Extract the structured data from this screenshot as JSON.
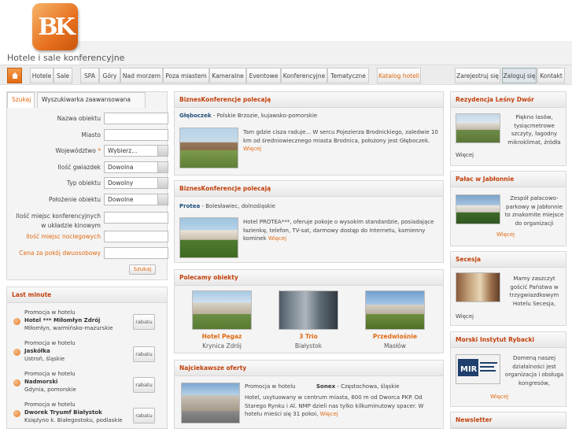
{
  "site": {
    "logo_text": "BK",
    "tagline": "Hotele i sale konferencyjne"
  },
  "nav": {
    "home_icon": "home-icon",
    "items": [
      "Hotele",
      "Sale",
      "SPA",
      "Góry",
      "Nad morzem",
      "Poza miastem",
      "Kameralne",
      "Eventowe",
      "Konferencyjne",
      "Tematyczne"
    ],
    "catalog": "Katalog hoteli",
    "register": "Zarejestruj się",
    "login": "Zaloguj się",
    "contact": "Kontakt"
  },
  "search": {
    "tab_simple": "Szukaj",
    "tab_advanced": "Wyszukiwarka zaawansowana",
    "label_name": "Nazwa obiektu",
    "label_city": "Miasto",
    "label_province": "Województwo",
    "province_value": "Wybierz...",
    "label_stars": "Ilość gwiazdek",
    "stars_value": "Dowolna",
    "label_type": "Typ obiektu",
    "type_value": "Dowolny",
    "label_location": "Położenie obiektu",
    "location_value": "Dowolne",
    "label_conf_line1": "Ilość miejsc konferencyjnych",
    "label_conf_line2": "w układzie kinowym",
    "label_beds": "Ilość miejsc noclegowych",
    "label_price": "Cena za pokój dwuosobowy",
    "submit": "Szukaj"
  },
  "last_minute": {
    "title": "Last minute",
    "items": [
      {
        "promo": "Promocja w hotelu",
        "name": "Hotel *** Miłomłyn Zdrój",
        "place": "Miłomłyn, warmińsko-mazurskie",
        "badge": "rabatu"
      },
      {
        "promo": "Promocja w hotelu",
        "name": "Jaskółka",
        "place": "Ustroń, śląskie",
        "badge": "rabatu"
      },
      {
        "promo": "Promocja w hotelu",
        "name": "Nadmorski",
        "place": "Gdynia, pomorskie",
        "badge": "rabatu"
      },
      {
        "promo": "Promocja w hotelu",
        "name": "Dworek Tryumf Białystok",
        "place": "Księżyno k. Białegostoku, podlaskie",
        "badge": "rabatu"
      }
    ]
  },
  "recommend1": {
    "title": "BiznesKonferencje polecają",
    "name": "Głęboczek",
    "location": " - Polskie Brzozie, kujawsko-pomorskie",
    "text": "Tam gdzie cisza raduje... W sercu Pojezierza Brodnickiego, zaledwie 10 km od średniowiecznego miasta Brodnica, położony jest Głęboczek.",
    "more": "Więcej"
  },
  "recommend2": {
    "title": "BiznesKonferencje polecają",
    "name": "Protea",
    "location": " - Bolesławiec, dolnośląskie",
    "text": "Hotel PROTEA***, oferuje pokoje o wysokim standardzie, posiadające łazienkę, telefon, TV-sat, darmowy dostęp do Internetu, kamienny kominek",
    "more": "Więcej"
  },
  "featured": {
    "title": "Polecamy obiekty",
    "items": [
      {
        "name": "Hotel Pegaz",
        "city": "Krynica Zdrój"
      },
      {
        "name": "3 Trio",
        "city": "Białystok"
      },
      {
        "name": "Przedwiośnie",
        "city": "Masłów"
      }
    ]
  },
  "offers": {
    "title": "Najciekawsze oferty",
    "promo": "Promocja w hotelu",
    "name": "Sonex",
    "location": " - Częstochowa, śląskie",
    "text": "Hotel, usytuowany w centrum miasta, 600 m od Dworca PKP. Od Starego Rynku i Al. NMP dzieli nas tylko kilkuminutowy spacer. W hotelu mieści się 31 pokoi,",
    "more": "Więcej"
  },
  "right": {
    "boxes": [
      {
        "title": "Rezydencja Leśny Dwór",
        "text": "Piękno lasów, tysiącmetrowe szczyty, łagodny mikroklimat, źródła",
        "more": "Więcej"
      },
      {
        "title": "Pałac w Jabłonnie",
        "text": "Zespół pałacowo-parkowy w Jabłonnie to znakomite miejsce do organizacji",
        "more": "Więcej"
      },
      {
        "title": "Secesja",
        "text": "Mamy zaszczyt gościć Państwa w trzygwiazdkowym Hotelu Secesja,",
        "more": "Więcej"
      },
      {
        "title": "Morski Instytut Rybacki",
        "text": "Domeną naszej działalności jest organizacja i obsługa kongresów,",
        "more": "Więcej"
      }
    ],
    "newsletter": "Newsletter"
  },
  "colors": {
    "accent": "#e06a12",
    "heading": "#c2410c",
    "panel": "#f4f4f4"
  }
}
